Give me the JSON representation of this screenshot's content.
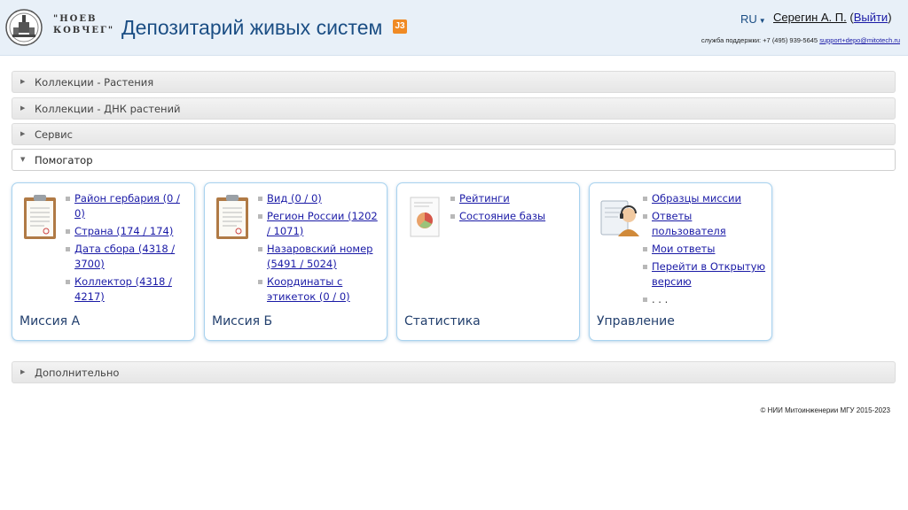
{
  "header": {
    "logo_line1": "\"НОЕВ",
    "logo_line2": "КОВЧЕГ\"",
    "title": "Депозитарий живых систем",
    "badge": "J3",
    "lang": "RU",
    "user_name": "Серегин А. П.",
    "logout": "Выйти",
    "support_label": "служба поддержки: +7 (495) 939-5645",
    "support_email": "support+depo@mitotech.ru"
  },
  "accordion": [
    {
      "label": "Коллекции - Растения",
      "open": false
    },
    {
      "label": "Коллекции - ДНК растений",
      "open": false
    },
    {
      "label": "Сервис",
      "open": false
    },
    {
      "label": "Помогатор",
      "open": true
    }
  ],
  "cards": [
    {
      "title": "Миссия А",
      "icon": "clipboard-icon",
      "links": [
        {
          "text": "Район гербария (0 / 0)"
        },
        {
          "text": "Страна (174 / 174)"
        },
        {
          "text": "Дата сбора (4318 / 3700)"
        },
        {
          "text": "Коллектор (4318 / 4217)"
        }
      ]
    },
    {
      "title": "Миссия Б",
      "icon": "clipboard-icon",
      "links": [
        {
          "text": "Вид (0 / 0)"
        },
        {
          "text": "Регион России (1202 / 1071)"
        },
        {
          "text": "Назаровский номер (5491 / 5024)"
        },
        {
          "text": "Координаты с этикеток (0 / 0)"
        }
      ]
    },
    {
      "title": "Статистика",
      "icon": "report-chart-icon",
      "links": [
        {
          "text": "Рейтинги"
        },
        {
          "text": "Состояние базы"
        }
      ]
    },
    {
      "title": "Управление",
      "icon": "support-operator-icon",
      "links": [
        {
          "text": "Образцы миссии"
        },
        {
          "text": "Ответы пользователя"
        },
        {
          "text": "Мои ответы"
        },
        {
          "text": "Перейти в Открытую версию"
        },
        {
          "text": ". . ."
        }
      ]
    }
  ],
  "extra_section": {
    "label": "Дополнительно"
  },
  "footer": "© НИИ Митоинженерии МГУ 2015-2023",
  "colors": {
    "header_bg": "#e8f0f8",
    "title": "#1b4e84",
    "link": "#1a1aa6",
    "card_border": "#a9d3ef",
    "badge": "#f08a24"
  }
}
